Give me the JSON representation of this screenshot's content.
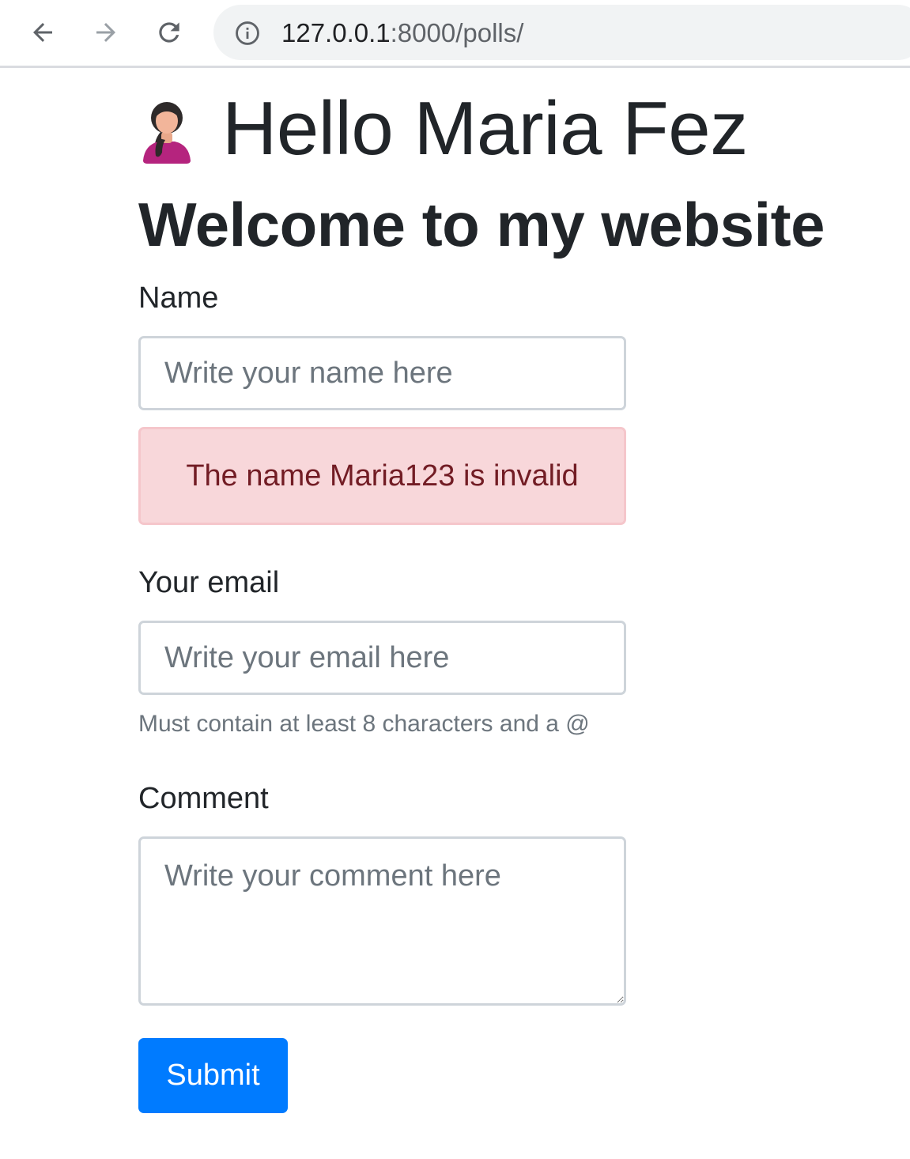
{
  "browser": {
    "url_host": "127.0.0.1",
    "url_rest": ":8000/polls/",
    "icons": {
      "back": "arrow-left",
      "forward": "arrow-right",
      "reload": "reload",
      "site_info": "info-circle"
    }
  },
  "header": {
    "greeting": "Hello Maria Fez",
    "avatar": "female-user-avatar",
    "title": "Welcome to my website"
  },
  "form": {
    "name": {
      "label": "Name",
      "placeholder": "Write your name here",
      "value": ""
    },
    "name_error": "The name Maria123 is invalid",
    "email": {
      "label": "Your email",
      "placeholder": "Write your email here",
      "value": "",
      "help": "Must contain at least 8 characters and a @"
    },
    "comment": {
      "label": "Comment",
      "placeholder": "Write your comment here",
      "value": ""
    },
    "submit_label": "Submit"
  },
  "colors": {
    "primary": "#007bff",
    "alert_bg": "#f8d7da",
    "alert_text": "#721c24",
    "text": "#212529",
    "muted": "#6c757d"
  }
}
